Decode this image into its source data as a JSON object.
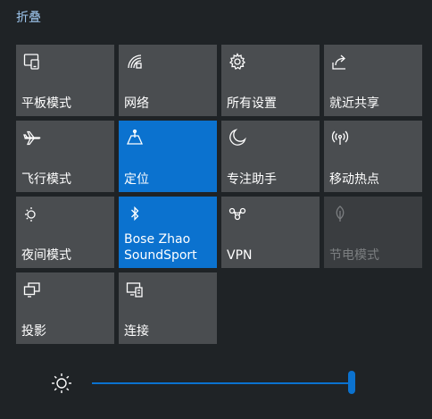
{
  "header": {
    "collapse_label": "折叠"
  },
  "tiles": [
    {
      "label": "平板模式",
      "icon": "tablet-mode-icon",
      "state": "off"
    },
    {
      "label": "网络",
      "icon": "network-icon",
      "state": "off"
    },
    {
      "label": "所有设置",
      "icon": "gear-icon",
      "state": "off"
    },
    {
      "label": "就近共享",
      "icon": "share-icon",
      "state": "off"
    },
    {
      "label": "飞行模式",
      "icon": "airplane-icon",
      "state": "off"
    },
    {
      "label": "定位",
      "icon": "location-icon",
      "state": "on"
    },
    {
      "label": "专注助手",
      "icon": "moon-icon",
      "state": "off"
    },
    {
      "label": "移动热点",
      "icon": "hotspot-icon",
      "state": "off"
    },
    {
      "label": "夜间模式",
      "icon": "night-light-icon",
      "state": "off"
    },
    {
      "label": "Bose Zhao\nSoundSport",
      "icon": "bluetooth-icon",
      "state": "on"
    },
    {
      "label": "VPN",
      "icon": "vpn-icon",
      "state": "off"
    },
    {
      "label": "节电模式",
      "icon": "battery-saver-icon",
      "state": "disabled"
    },
    {
      "label": "投影",
      "icon": "project-icon",
      "state": "off"
    },
    {
      "label": "连接",
      "icon": "connect-icon",
      "state": "off"
    }
  ],
  "brightness": {
    "icon": "brightness-icon",
    "level": 0.97
  },
  "colors": {
    "accent": "#0b72cf",
    "tile": "#4a4d50",
    "background": "#1f2326",
    "link": "#9ec6ee"
  }
}
